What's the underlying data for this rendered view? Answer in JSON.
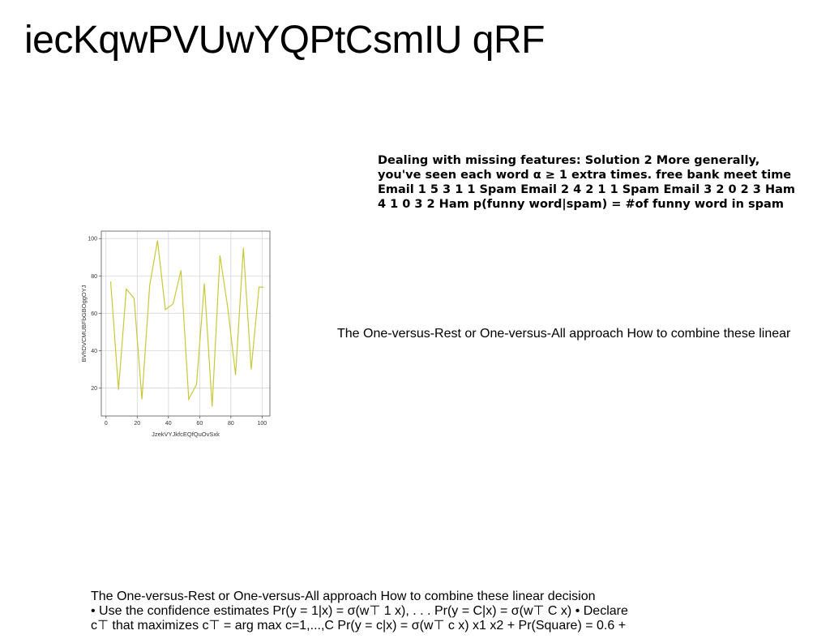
{
  "title": "iecKqwPVUwYQPtCsmIU qRF",
  "bold_paragraph": "Dealing with missing features: Solution 2 More generally, you've seen each word α ≥ 1 extra times. free bank meet time Email 1 5 3 1 1 Spam Email 2 4 2 1 1 Spam Email 3 2 0 2 3 Ham 4 1 0 3 2 Ham p(funny word|spam) = #of funny word in spam",
  "middle_text": "The One-versus-Rest or One-versus-All approach How to combine these linear",
  "bottom_lines": [
    "The One-versus-Rest or One-versus-All approach How to combine these linear decision",
    "• Use the confidence estimates Pr(y = 1|x) = σ(w⊤ 1 x), . . . Pr(y = C|x) = σ(w⊤ C x) • Declare",
    "c⊤ that maximizes c⊤ = arg max c=1,...,C Pr(y = c|x) = σ(w⊤ c x) x1 x2 + Pr(Square) = 0.6 +"
  ],
  "chart_data": {
    "type": "line",
    "xlabel": "JzekVYJkfcEQfQuOvSxk",
    "ylabel": "BVhDVCMUBFbGBOggOYJ",
    "xlim": [
      -3,
      105
    ],
    "ylim": [
      5,
      104
    ],
    "xticks": [
      0,
      20,
      40,
      60,
      80,
      100
    ],
    "yticks": [
      20,
      40,
      60,
      80,
      100
    ],
    "grid": true,
    "line_color": "#c8c83a",
    "series": [
      {
        "x": [
          3,
          8,
          13,
          18,
          23,
          28,
          33,
          38,
          43,
          48,
          53,
          58,
          63,
          68,
          73,
          78,
          83,
          88,
          93,
          98,
          101
        ],
        "y": [
          77,
          19,
          73,
          68,
          14,
          75,
          99,
          62,
          65,
          83,
          14,
          22,
          76,
          10,
          91,
          63,
          27,
          95,
          30,
          74,
          74
        ]
      }
    ]
  }
}
